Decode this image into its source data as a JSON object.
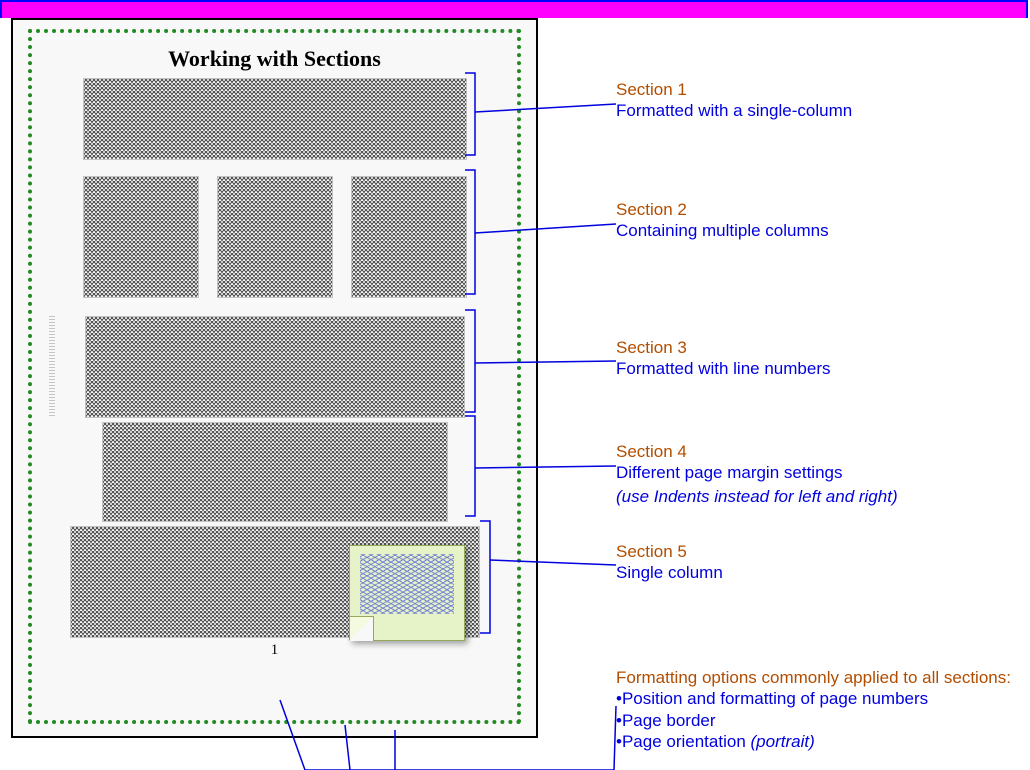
{
  "page_title": "Working with Sections",
  "page_number": "1",
  "annotations": [
    {
      "label": "Section 1",
      "description": "Formatted with a single-column"
    },
    {
      "label": "Section 2",
      "description": "Containing multiple columns"
    },
    {
      "label": "Section 3",
      "description": "Formatted with line numbers"
    },
    {
      "label": "Section 4",
      "description": "Different page margin settings",
      "hint": "(use Indents instead for left and right)"
    },
    {
      "label": "Section 5",
      "description": "Single column"
    }
  ],
  "common": {
    "heading": "Formatting options commonly applied to all sections:",
    "bullets": [
      {
        "text": "Position and formatting of page numbers"
      },
      {
        "text": "Page border"
      },
      {
        "text": "Page orientation",
        "paren": "(portrait)"
      }
    ]
  }
}
